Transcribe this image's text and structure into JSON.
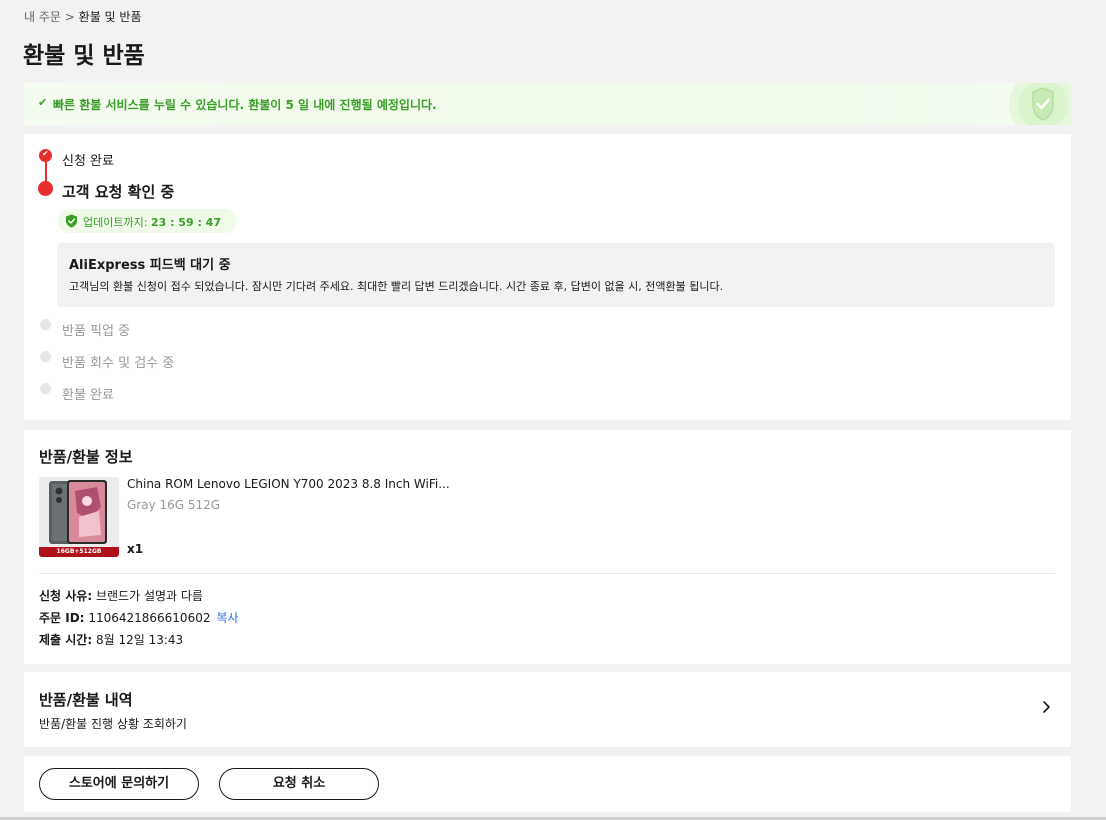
{
  "breadcrumb": {
    "parent": "내 주문",
    "separator": ">",
    "current": "환불 및 반품"
  },
  "page_title": "환불 및 반품",
  "banner": {
    "check": "✔",
    "message": "빠른 환불 서비스를 누릴 수 있습니다. 환불이 5 일 내에 진행될 예정입니다."
  },
  "progress": {
    "step_done": "신청 완료",
    "step_active": "고객 요청 확인 중",
    "timer_label": "업데이트까지: ",
    "timer_value": "23 : 59 : 47",
    "feedback_title": "AliExpress 피드백 대기 중",
    "feedback_desc": "고객님의 환불 신청이 접수 되었습니다. 잠시만 기다려 주세요. 최대한 빨리 답변 드리겠습니다. 시간 종료 후, 답변이 없을 시, 전액환불 됩니다.",
    "pending_steps": [
      "반품 픽업 중",
      "반품 회수 및 검수 중",
      "환불 완료"
    ]
  },
  "info": {
    "title": "반품/환불 정보",
    "product_title": "China ROM Lenovo LEGION Y700 2023 8.8 Inch WiFi...",
    "product_sku": "Gray 16G 512G",
    "product_qty": "x1",
    "thumb_badge": "16GB+512GB",
    "reason_key": "신청 사유:",
    "reason_val": "브랜드가 설명과 다름",
    "order_key": "주문 ID:",
    "order_val": "1106421866610602",
    "copy_label": "복사",
    "time_key": "제출 시간:",
    "time_val": "8월 12일 13:43"
  },
  "history": {
    "title": "반품/환불 내역",
    "subtitle": "반품/환불 진행 상황 조회하기"
  },
  "actions": {
    "contact_store": "스토어에 문의하기",
    "cancel_request": "요청 취소"
  },
  "colors": {
    "accent_red": "#e62e2e",
    "success_green": "#3a9e29",
    "link_blue": "#2e6fe0"
  }
}
